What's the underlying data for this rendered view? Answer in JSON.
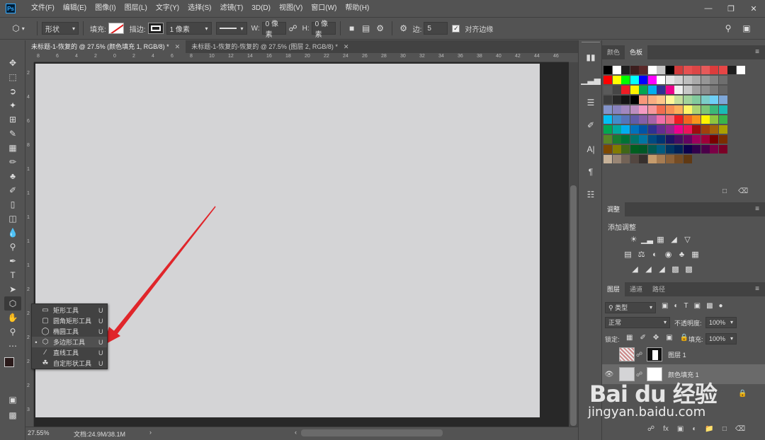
{
  "app": {
    "logo": "Ps"
  },
  "menu": [
    "文件(F)",
    "编辑(E)",
    "图像(I)",
    "图层(L)",
    "文字(Y)",
    "选择(S)",
    "滤镜(T)",
    "3D(D)",
    "视图(V)",
    "窗口(W)",
    "帮助(H)"
  ],
  "options": {
    "shape_mode": "形状",
    "fill_label": "填充:",
    "stroke_label": "描边:",
    "stroke_width": "1 像素",
    "w_label": "W:",
    "w_value": "0 像素",
    "h_label": "H:",
    "h_value": "0 像素",
    "sides_label": "边:",
    "sides_value": "5",
    "align_edges_label": "对齐边缘",
    "align_edges_checked": true
  },
  "tabs": [
    {
      "label": "未标题-1-恢复的 @ 27.5% (颜色填充 1, RGB/8) *",
      "active": true
    },
    {
      "label": "未标题-1-恢复的-恢复的 @ 27.5% (图层 2, RGB/8) *",
      "active": false
    }
  ],
  "ruler_h": [
    "8",
    "6",
    "4",
    "2",
    "0",
    "2",
    "4",
    "6",
    "8",
    "10",
    "12",
    "14",
    "16",
    "18",
    "20",
    "22",
    "24",
    "26",
    "28",
    "30",
    "32",
    "34",
    "36",
    "38",
    "40",
    "42",
    "44",
    "46"
  ],
  "ruler_v": [
    "2",
    "4",
    "6",
    "8",
    "1",
    "1",
    "1",
    "1",
    "1",
    "2",
    "2",
    "2",
    "2",
    "2",
    "3"
  ],
  "flyout": [
    {
      "label": "矩形工具",
      "key": "U",
      "icon": "rectangle-icon",
      "selected": false
    },
    {
      "label": "圆角矩形工具",
      "key": "U",
      "icon": "rounded-rectangle-icon",
      "selected": false
    },
    {
      "label": "椭圆工具",
      "key": "U",
      "icon": "ellipse-icon",
      "selected": false
    },
    {
      "label": "多边形工具",
      "key": "U",
      "icon": "polygon-icon",
      "selected": true
    },
    {
      "label": "直线工具",
      "key": "U",
      "icon": "line-icon",
      "selected": false
    },
    {
      "label": "自定形状工具",
      "key": "U",
      "icon": "custom-shape-icon",
      "selected": false
    }
  ],
  "status": {
    "zoom": "27.55%",
    "doc": "文档:24.9M/38.1M"
  },
  "panels": {
    "color_tab": "颜色",
    "swatches_tab": "色板",
    "adjust_tab": "调整",
    "adjust_title": "添加调整",
    "layers_tab": "图层",
    "channels_tab": "通道",
    "paths_tab": "路径",
    "kind_filter": "类型",
    "blend_mode": "正常",
    "opacity_label": "不透明度:",
    "opacity_value": "100%",
    "lock_label": "锁定:",
    "fill_label": "填充:",
    "fill_value": "100%",
    "layers": [
      {
        "name": "图层 1",
        "visible": false,
        "selected": false
      },
      {
        "name": "颜色填充 1",
        "visible": true,
        "selected": true
      }
    ]
  },
  "swatches": [
    [
      "#000000",
      "#ffffff",
      "#1e1e1e",
      "#3c1e1e",
      "#5a2828",
      "#ffffff",
      "#c8c8c8",
      "#000000",
      "#d23c3c",
      "#e65050",
      "#dc4646",
      "#e65a5a",
      "#dc3c3c",
      "#e64646",
      "#1e1e1e",
      "#ffffff"
    ],
    [
      "#ff0000",
      "#ffff00",
      "#00ff00",
      "#00ffff",
      "#0000ff",
      "#ff00ff",
      "#ffffff",
      "#e6e6e6",
      "#d2d2d2",
      "#bebebe",
      "#aaaaaa",
      "#969696",
      "#828282",
      "#6e6e6e"
    ],
    [
      "#5a5a5a",
      "#464646",
      "#ed1c24",
      "#fff200",
      "#00a651",
      "#00aeef",
      "#2e3192",
      "#ec008c",
      "#f0f0f0",
      "#c8c8c8",
      "#a0a0a0",
      "#8c8c8c",
      "#787878",
      "#646464"
    ],
    [
      "#3c3c3c",
      "#282828",
      "#141414",
      "#000000",
      "#f7977a",
      "#f9ad81",
      "#fdc68a",
      "#fff79a",
      "#c4df9b",
      "#a2d39c",
      "#82ca9d",
      "#7bcdc8",
      "#6ecff6",
      "#7ea7d8"
    ],
    [
      "#8393ca",
      "#8882be",
      "#a187be",
      "#bc8dbf",
      "#f49ac2",
      "#f6989d",
      "#f26c4f",
      "#f68e55",
      "#fbaf5c",
      "#fff467",
      "#acd372",
      "#7cc576",
      "#3bb878",
      "#1abbb4"
    ],
    [
      "#00bff3",
      "#438cca",
      "#5574b9",
      "#605ca8",
      "#855fa8",
      "#a763a8",
      "#f06ea9",
      "#f26d7d",
      "#ed1c24",
      "#f26522",
      "#f7941d",
      "#fff200",
      "#8dc63f",
      "#39b54a"
    ],
    [
      "#00a651",
      "#00a99d",
      "#00aeef",
      "#0072bc",
      "#0054a6",
      "#2e3192",
      "#662d91",
      "#92278f",
      "#ec008c",
      "#ed145b",
      "#9e0b0f",
      "#a0410d",
      "#a3620a",
      "#aba000"
    ],
    [
      "#598527",
      "#197b30",
      "#007236",
      "#00746b",
      "#0076a3",
      "#004a80",
      "#003471",
      "#1b1464",
      "#440e62",
      "#630460",
      "#9e005d",
      "#9e0039",
      "#790000",
      "#7b2e00"
    ],
    [
      "#7d4900",
      "#827b00",
      "#406618",
      "#005e20",
      "#005826",
      "#005952",
      "#005b7f",
      "#003663",
      "#002157",
      "#0d004c",
      "#32004b",
      "#4b0049",
      "#7b0046",
      "#7a0026"
    ],
    [
      "#c7b299",
      "#998675",
      "#736357",
      "#534741",
      "#37302d",
      "#c69c6d",
      "#a67c52",
      "#8c6239",
      "#754c24",
      "#603913"
    ]
  ],
  "colors": {
    "accent_red": "#e0262b",
    "canvas": "#d4d4d6",
    "panel": "#535353",
    "dark": "#424242"
  },
  "watermark": {
    "brand": "Bai du 经验",
    "url": "jingyan.baidu.com"
  }
}
